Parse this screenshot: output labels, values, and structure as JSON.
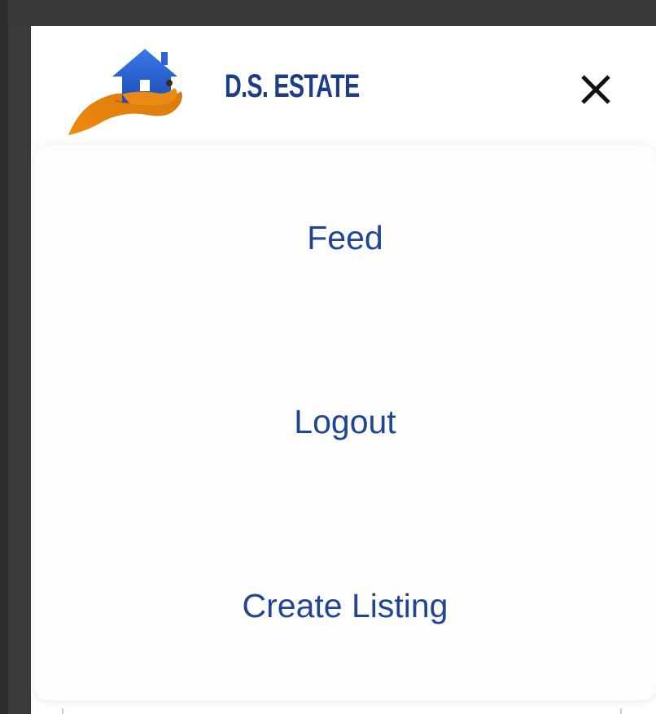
{
  "header": {
    "brand_name": "D.S. ESTATE",
    "logo_icon": "house-in-hand-logo",
    "close_icon": "close-icon"
  },
  "menu": {
    "items": [
      {
        "label": "Feed"
      },
      {
        "label": "Logout"
      },
      {
        "label": "Create Listing"
      }
    ]
  },
  "colors": {
    "brand_blue": "#1d3e85",
    "link_blue": "#1f4593",
    "logo_house_blue": "#2b63d6",
    "logo_hand_orange": "#e8860f",
    "frame_dark": "#3b3b3b"
  }
}
